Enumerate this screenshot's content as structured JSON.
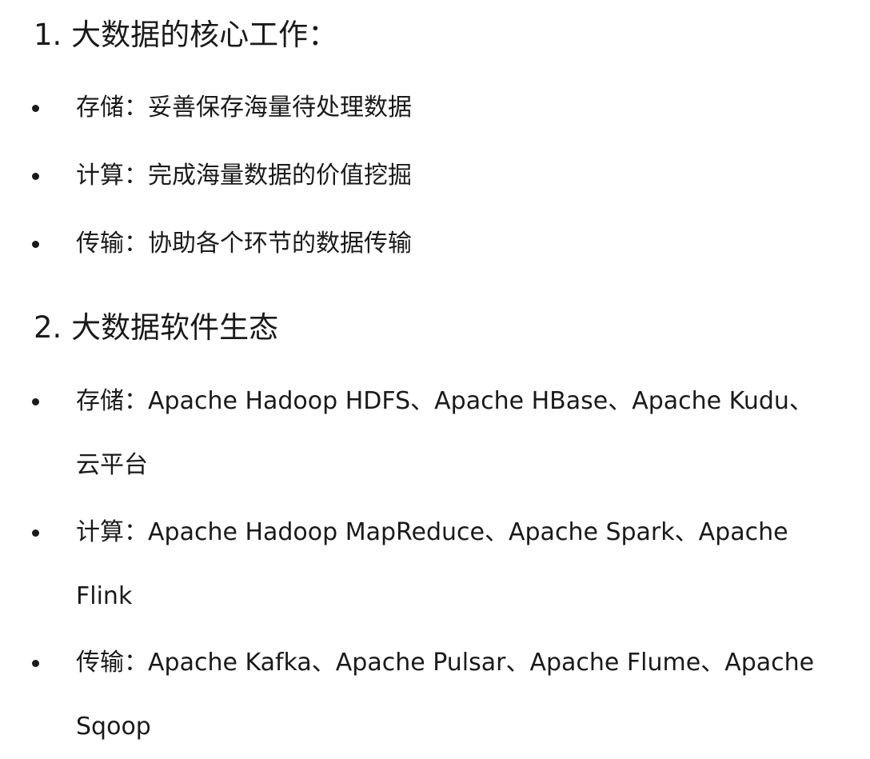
{
  "section1": {
    "heading": "1. 大数据的核心工作：",
    "items": [
      {
        "label": "存储：",
        "text": "妥善保存海量待处理数据"
      },
      {
        "label": "计算：",
        "text": "完成海量数据的价值挖掘"
      },
      {
        "label": "传输：",
        "text": "协助各个环节的数据传输"
      }
    ]
  },
  "section2": {
    "heading": "2. 大数据软件生态",
    "items": [
      {
        "label": "存储：",
        "line1": "Apache Hadoop HDFS、Apache HBase、Apache Kudu、",
        "line2": "云平台"
      },
      {
        "label": "计算：",
        "line1": "Apache Hadoop MapReduce、Apache Spark、Apache",
        "line2": "Flink"
      },
      {
        "label": "传输：",
        "line1": "Apache Kafka、Apache Pulsar、Apache Flume、Apache",
        "line2": "Sqoop"
      }
    ]
  }
}
